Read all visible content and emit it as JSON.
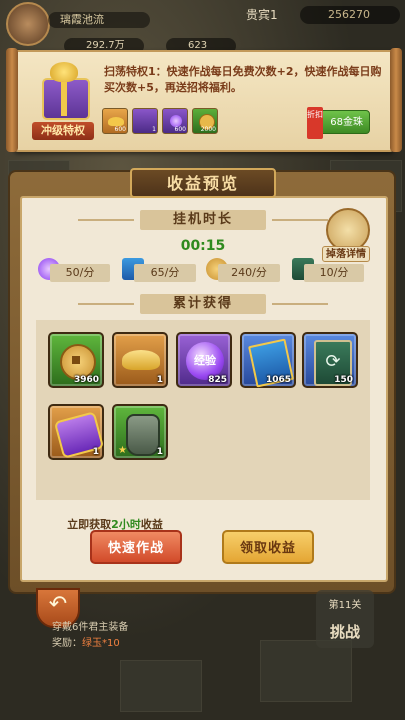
{
  "hud": {
    "player_name": "璃霞池流",
    "rank": "贵宾1",
    "power": "256270",
    "res_1": "292.7万",
    "res_2": "623"
  },
  "banner": {
    "label": "冲级特权",
    "text": "扫荡特权1：快速作战每日免费次数+2，快速作战每日购买次数+5，再送招将福利。",
    "discount": "折扣",
    "buy_label": "68金珠",
    "rewards": [
      {
        "icon": "gold-ingot-icon",
        "count": "600"
      },
      {
        "icon": "scroll-icon",
        "count": "1"
      },
      {
        "icon": "exp-orb-icon",
        "count": "600"
      },
      {
        "icon": "coin-icon",
        "count": "2000"
      }
    ]
  },
  "panel": {
    "title": "收益预览",
    "idle_heading": "挂机时长",
    "timer": "00:15",
    "detail_label": "掉落详情",
    "rates": [
      {
        "icon": "exp-orb-icon",
        "value": "50/分"
      },
      {
        "icon": "book-icon",
        "value": "65/分"
      },
      {
        "icon": "coin-icon",
        "value": "240/分"
      },
      {
        "icon": "card-icon",
        "value": "10/分"
      }
    ],
    "accumulated_heading": "累计获得",
    "items": [
      {
        "icon": "coin-icon",
        "count": "3960",
        "quality": "green"
      },
      {
        "icon": "gold-ingot-icon",
        "count": "1",
        "quality": "orange"
      },
      {
        "icon": "exp-orb-icon",
        "label": "经验",
        "count": "825",
        "quality": "purple"
      },
      {
        "icon": "book-icon",
        "count": "1065",
        "quality": "blue"
      },
      {
        "icon": "card-icon",
        "count": "150",
        "quality": "blue"
      },
      {
        "icon": "scroll-icon",
        "count": "1",
        "quality": "orange"
      },
      {
        "icon": "armor-icon",
        "count": "1",
        "quality": "green"
      }
    ],
    "hint_prefix": "立即获取",
    "hint_highlight": "2小时",
    "hint_suffix": "收益",
    "quick_battle_label": "快速作战",
    "claim_label": "领取收益"
  },
  "bottom": {
    "quest_text": "穿戴6件君主装备",
    "reward_prefix": "奖励：",
    "reward_value": "绿玉*10",
    "stage_level": "第11关",
    "challenge_label": "挑战"
  }
}
